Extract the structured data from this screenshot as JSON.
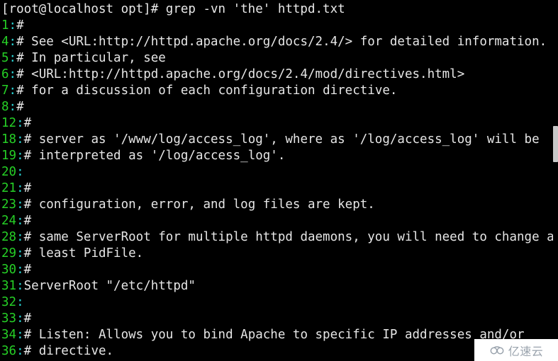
{
  "terminal": {
    "prompt": "[root@localhost opt]# grep -vn 'the' httpd.txt",
    "separator": ":",
    "colors": {
      "background": "#000000",
      "foreground": "#e6e6e6",
      "line_number": "#26cf26",
      "separator": "#2ad4d4",
      "scrollbar_thumb": "#c8c8c8"
    },
    "lines": [
      {
        "number": "1",
        "text": "#"
      },
      {
        "number": "4",
        "text": "# See <URL:http://httpd.apache.org/docs/2.4/> for detailed information."
      },
      {
        "number": "5",
        "text": "# In particular, see"
      },
      {
        "number": "6",
        "text": "# <URL:http://httpd.apache.org/docs/2.4/mod/directives.html>"
      },
      {
        "number": "7",
        "text": "# for a discussion of each configuration directive."
      },
      {
        "number": "8",
        "text": "#"
      },
      {
        "number": "12",
        "text": "#"
      },
      {
        "number": "18",
        "text": "# server as '/www/log/access_log', where as '/log/access_log' will be"
      },
      {
        "number": "19",
        "text": "# interpreted as '/log/access_log'."
      },
      {
        "number": "20",
        "text": ""
      },
      {
        "number": "21",
        "text": "#"
      },
      {
        "number": "23",
        "text": "# configuration, error, and log files are kept."
      },
      {
        "number": "24",
        "text": "#"
      },
      {
        "number": "28",
        "text": "# same ServerRoot for multiple httpd daemons, you will need to change at"
      },
      {
        "number": "29",
        "text": "# least PidFile."
      },
      {
        "number": "30",
        "text": "#"
      },
      {
        "number": "31",
        "text": "ServerRoot \"/etc/httpd\""
      },
      {
        "number": "32",
        "text": ""
      },
      {
        "number": "33",
        "text": "#"
      },
      {
        "number": "34",
        "text": "# Listen: Allows you to bind Apache to specific IP addresses and/or"
      },
      {
        "number": "36",
        "text": "# directive."
      }
    ]
  },
  "watermark": {
    "text": "亿速云",
    "icon": "cloud-icon"
  }
}
